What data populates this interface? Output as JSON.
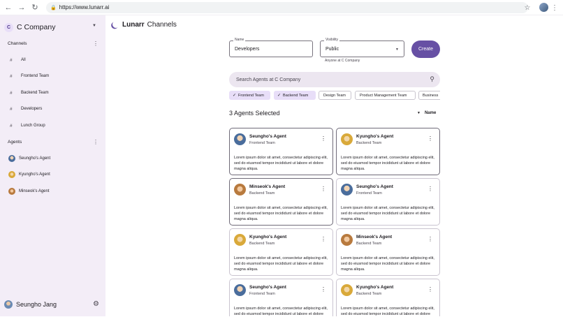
{
  "browser": {
    "url": "https://www.lunarr.ai"
  },
  "sidebar": {
    "company_initial": "C",
    "company_name": "C Company",
    "channels_header": "Channels",
    "channels": [
      "All",
      "Frontend Team",
      "Backend Team",
      "Developers",
      "Lunch Group"
    ],
    "agents_header": "Agents",
    "agents": [
      "Seungho's Agent",
      "Kyungho's Agent",
      "Minseok's Agent"
    ],
    "user_name": "Seungho Jang"
  },
  "header": {
    "brand": "Lunarr",
    "page": "Channels"
  },
  "form": {
    "name_label": "Name",
    "name_value": "Developers",
    "visibility_label": "Visibility",
    "visibility_value": "Public",
    "visibility_helper": "Anyone at C Company",
    "create_label": "Create"
  },
  "search": {
    "placeholder": "Search Agents at C Company"
  },
  "chips": [
    {
      "label": "Frontend Team",
      "selected": true
    },
    {
      "label": "Backend Team",
      "selected": true
    },
    {
      "label": "Design Team",
      "selected": false
    },
    {
      "label": "Product Management Team",
      "selected": false
    },
    {
      "label": "Business",
      "selected": false
    }
  ],
  "results": {
    "title": "3 Agents Selected",
    "sort_label": "Name"
  },
  "cards": [
    {
      "name": "Seungho's Agent",
      "team": "Frontend Team",
      "desc": "Lorem ipsum dolor sit amet, consectetur adipiscing elit, sed do eiusmod tempor incididunt ut labore et dolore magna aliqua."
    },
    {
      "name": "Kyungho's Agent",
      "team": "Backend Team",
      "desc": "Lorem ipsum dolor sit amet, consectetur adipiscing elit, sed do eiusmod tempor incididunt ut labore et dolore magna aliqua."
    },
    {
      "name": "Minseok's Agent",
      "team": "Backend Team",
      "desc": "Lorem ipsum dolor sit amet, consectetur adipiscing elit, sed do eiusmod tempor incididunt ut labore et dolore magna aliqua."
    },
    {
      "name": "Seungho's Agent",
      "team": "Frontend Team",
      "desc": "Lorem ipsum dolor sit amet, consectetur adipiscing elit, sed do eiusmod tempor incididunt ut labore et dolore magna aliqua."
    },
    {
      "name": "Kyungho's Agent",
      "team": "Backend Team",
      "desc": "Lorem ipsum dolor sit amet, consectetur adipiscing elit, sed do eiusmod tempor incididunt ut labore et dolore magna aliqua."
    },
    {
      "name": "Minseok's Agent",
      "team": "Backend Team",
      "desc": "Lorem ipsum dolor sit amet, consectetur adipiscing elit, sed do eiusmod tempor incididunt ut labore et dolore magna aliqua."
    },
    {
      "name": "Seungho's Agent",
      "team": "Frontend Team",
      "desc": "Lorem ipsum dolor sit amet, consectetur adipiscing elit, sed do eiusmod tempor incididunt ut labore et dolore magna aliqua."
    },
    {
      "name": "Kyungho's Agent",
      "team": "Backend Team",
      "desc": "Lorem ipsum dolor sit amet, consectetur adipiscing elit, sed do eiusmod tempor incididunt ut labore et dolore magna aliqua."
    }
  ],
  "colors": {
    "accent": "#6750a4",
    "sidebar_bg": "#f3edf7",
    "chip_selected": "#e8def8"
  }
}
